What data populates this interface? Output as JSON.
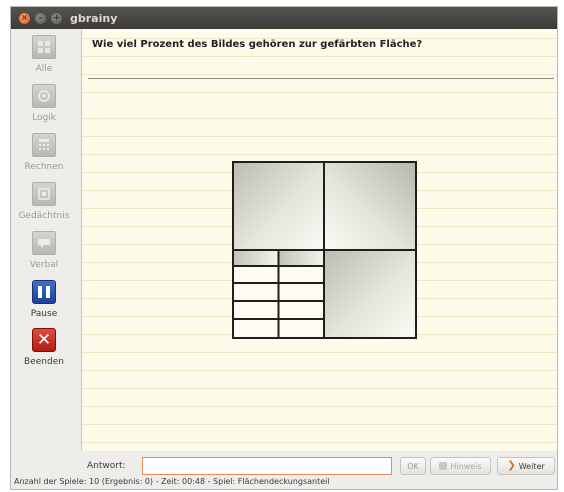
{
  "window": {
    "title": "gbrainy",
    "close_glyph": "×",
    "min_glyph": "–",
    "max_glyph": "+"
  },
  "sidebar": {
    "items": [
      {
        "label": "Alle",
        "icon": "all-games-icon",
        "enabled": false
      },
      {
        "label": "Logik",
        "icon": "logic-icon",
        "enabled": false
      },
      {
        "label": "Rechnen",
        "icon": "calculation-icon",
        "enabled": false
      },
      {
        "label": "Gedächtnis",
        "icon": "memory-icon",
        "enabled": false
      },
      {
        "label": "Verbal",
        "icon": "verbal-icon",
        "enabled": false
      },
      {
        "label": "Pause",
        "icon": "pause-icon",
        "enabled": true
      },
      {
        "label": "Beenden",
        "icon": "exit-icon",
        "glyph": "✕",
        "enabled": true
      }
    ]
  },
  "main": {
    "question": "Wie viel Prozent des Bildes gehören zur gefärbten Fläche?"
  },
  "answer": {
    "label": "Antwort:",
    "value": "",
    "ok_label": "OK",
    "hint_label": "Hinweis",
    "next_label": "Weiter",
    "next_glyph": "❯"
  },
  "status": {
    "text": "Anzahl der Spiele: 10 (Ergebnis: 0) - Zeit: 00:48 - Spiel: Flächendeckungsanteil"
  },
  "colors": {
    "paper": "#fdfbe9",
    "paper_lines": "#ede7c6",
    "accent": "#e06a18",
    "pause_blue": "#1c3f9c",
    "exit_red": "#b01e14"
  }
}
